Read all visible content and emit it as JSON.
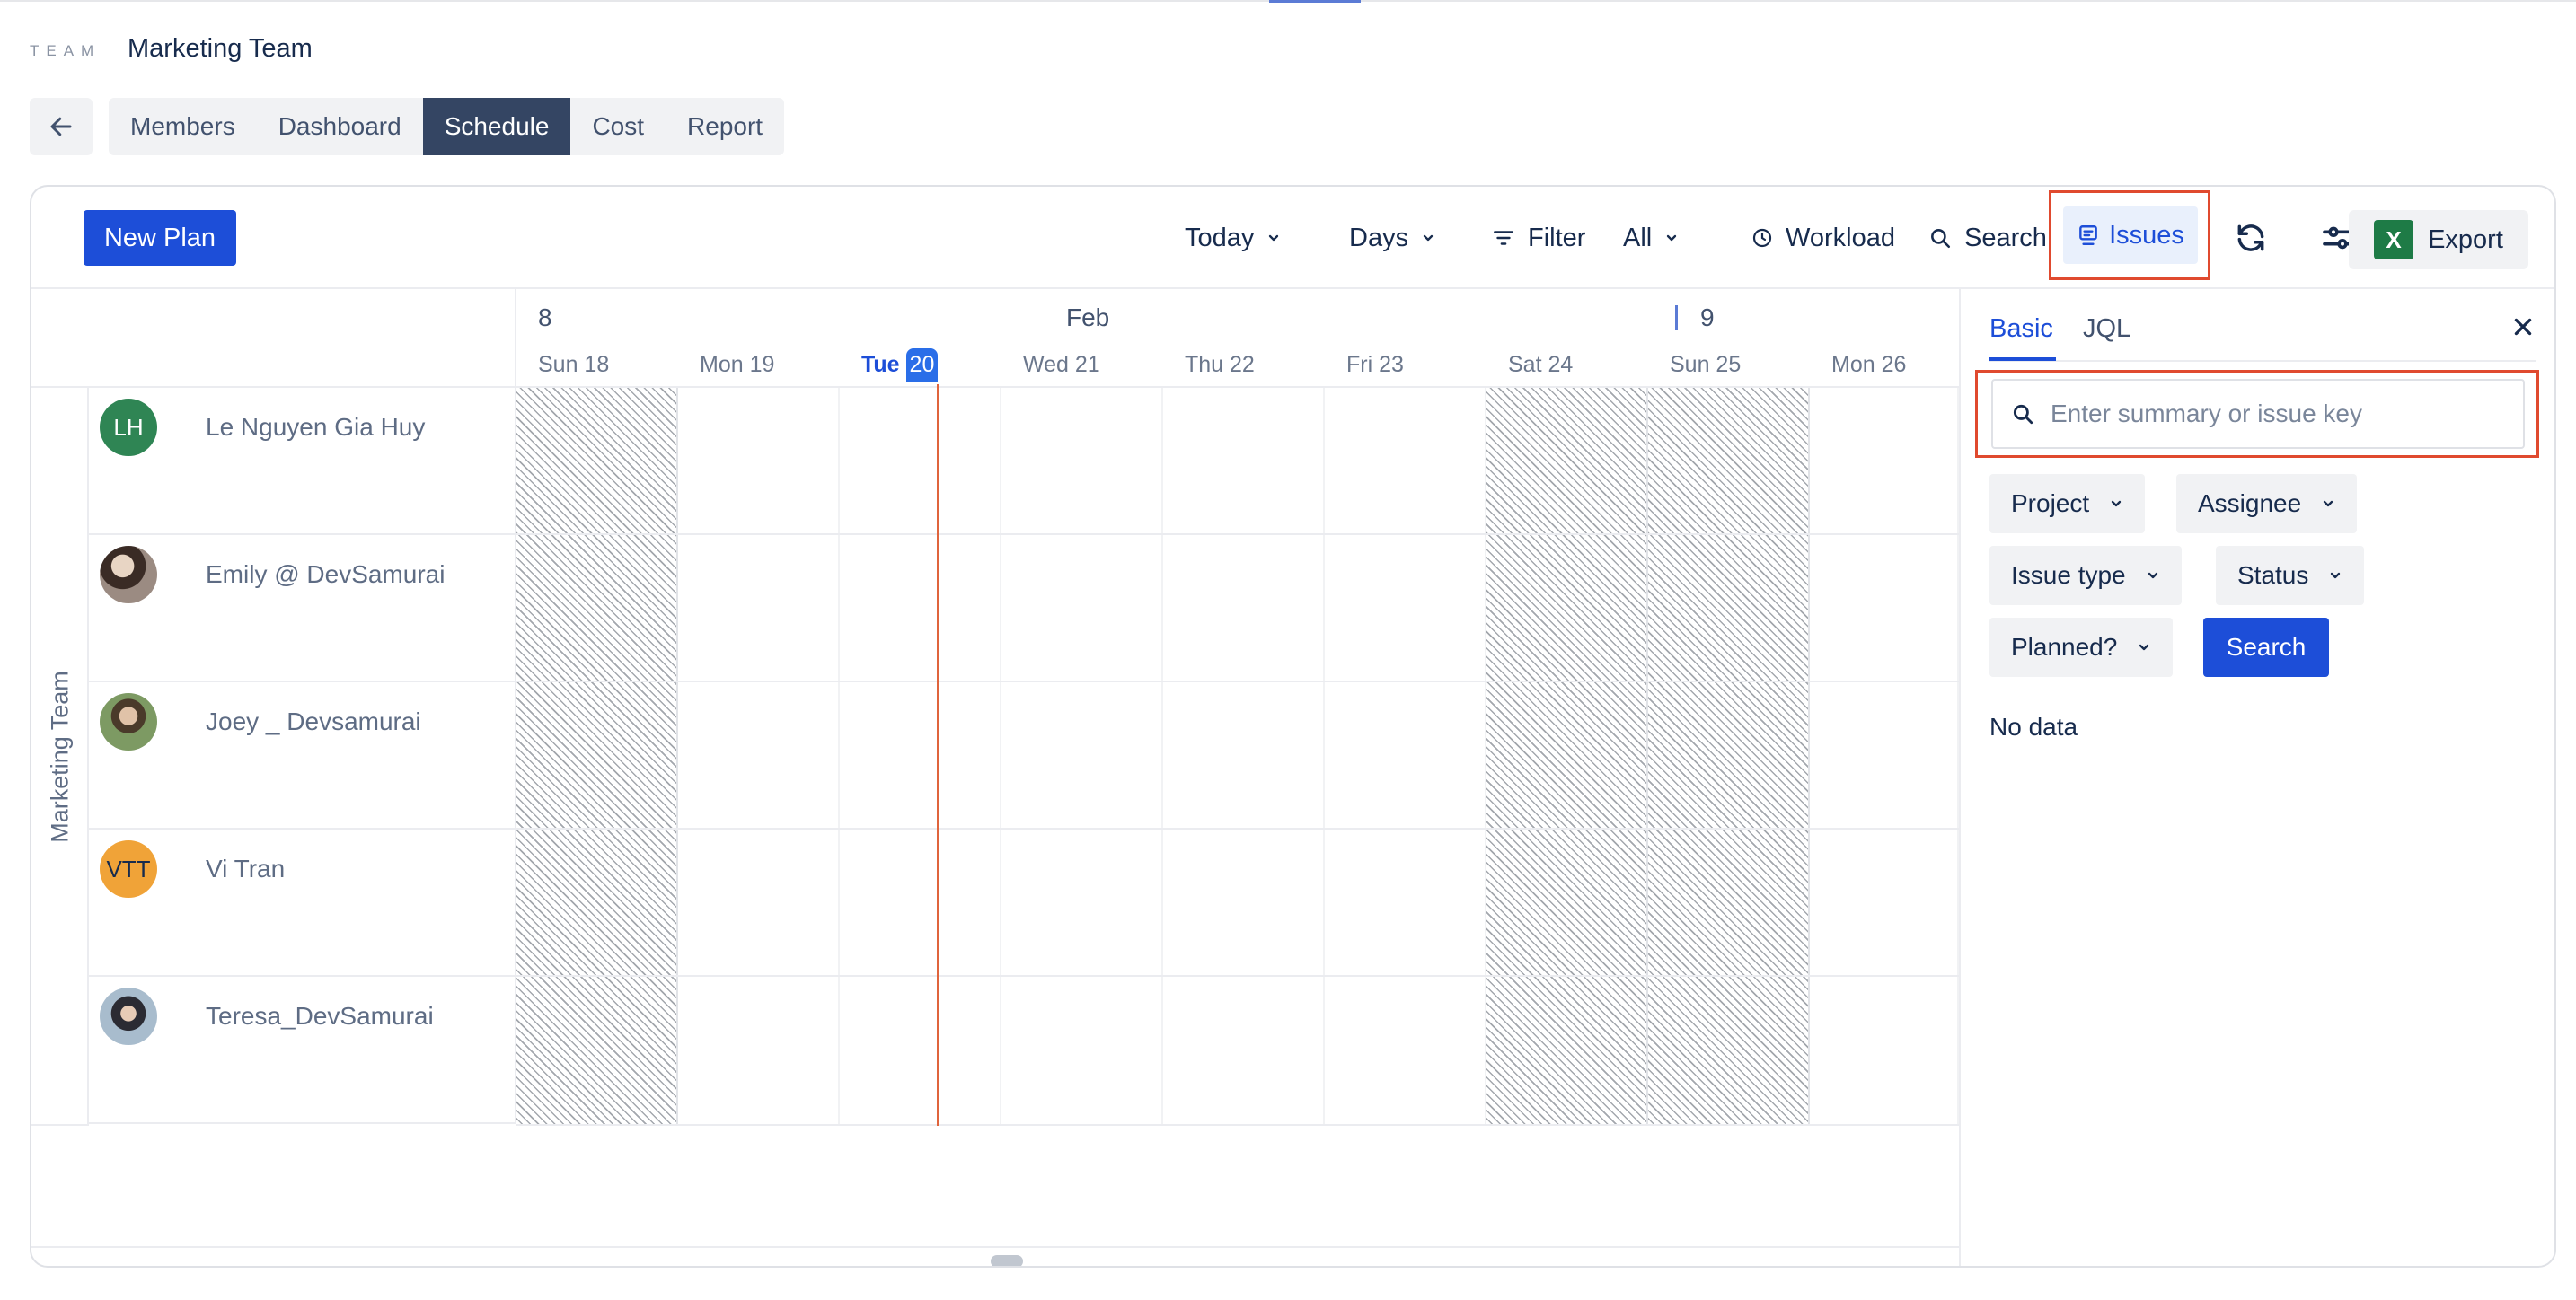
{
  "header": {
    "team_tag": "TEAM",
    "team_name": "Marketing Team"
  },
  "nav": {
    "back_icon": "arrow-left-icon",
    "tabs": [
      {
        "label": "Members",
        "active": false
      },
      {
        "label": "Dashboard",
        "active": false
      },
      {
        "label": "Schedule",
        "active": true
      },
      {
        "label": "Cost",
        "active": false
      },
      {
        "label": "Report",
        "active": false
      }
    ]
  },
  "toolbar": {
    "new_plan": "New Plan",
    "today": "Today",
    "days": "Days",
    "filter": "Filter",
    "all": "All",
    "workload": "Workload",
    "search": "Search",
    "issues": "Issues",
    "export": "Export",
    "excel_letter": "X"
  },
  "calendar": {
    "week_start": "8",
    "month": "Feb",
    "week_next": "9",
    "days": [
      {
        "label": "Sun 18",
        "weekend": true
      },
      {
        "label": "Mon 19",
        "weekend": false
      },
      {
        "label": "Tue",
        "today_num": "20",
        "weekend": false,
        "today": true
      },
      {
        "label": "Wed 21",
        "weekend": false
      },
      {
        "label": "Thu 22",
        "weekend": false
      },
      {
        "label": "Fri 23",
        "weekend": false
      },
      {
        "label": "Sat 24",
        "weekend": true
      },
      {
        "label": "Sun 25",
        "weekend": true
      },
      {
        "label": "Mon 26",
        "weekend": false
      }
    ]
  },
  "team_label": "Marketing Team",
  "members": [
    {
      "name": "Le Nguyen Gia Huy",
      "initials": "LH",
      "color": "#2f8554"
    },
    {
      "name": "Emily @ DevSamurai",
      "initials": "",
      "color": "#6b5a52"
    },
    {
      "name": "Joey _ Devsamurai",
      "initials": "",
      "color": "#6f8a5c"
    },
    {
      "name": "Vi Tran",
      "initials": "VTT",
      "color": "#f0a338"
    },
    {
      "name": "Teresa_DevSamurai",
      "initials": "",
      "color": "#5a7186"
    }
  ],
  "panel": {
    "tab_basic": "Basic",
    "tab_jql": "JQL",
    "search_placeholder": "Enter summary or issue key",
    "filters": {
      "project": "Project",
      "assignee": "Assignee",
      "issue_type": "Issue type",
      "status": "Status",
      "planned": "Planned?"
    },
    "search_button": "Search",
    "no_data": "No data"
  },
  "colors": {
    "primary": "#1d4ed8",
    "highlight_box": "#e04a2f",
    "today_line": "#e0643c",
    "active_tab": "#344563"
  }
}
